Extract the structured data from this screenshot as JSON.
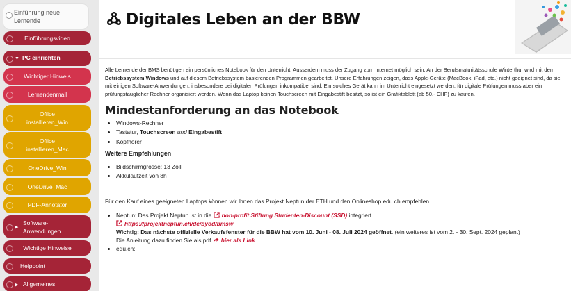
{
  "nav": {
    "top_label": "Einführung neue Lernende",
    "items": [
      {
        "label": "Einführungsvideo"
      },
      {
        "label": "PC einrichten"
      },
      {
        "label": "Wichtiger Hinweis"
      },
      {
        "label": "Lernendenmail"
      },
      {
        "label": "Office installieren_Win"
      },
      {
        "label": "Office installieren_Mac"
      },
      {
        "label": "OneDrive_Win"
      },
      {
        "label": "OneDrive_Mac"
      },
      {
        "label": "PDF-Annotator"
      },
      {
        "label": "Software-Anwendungen"
      },
      {
        "label": "Wichtige Hinweise"
      },
      {
        "label": "Helppoint"
      },
      {
        "label": "Allgemeines"
      }
    ]
  },
  "page": {
    "title": "Digitales Leben an der BBW",
    "intro": {
      "t1": "Alle Lernende der BMS benötigen ein persönliches Notebook für den Unterricht. Ausserdem muss der Zugang zum Internet möglich sein. An der Berufsmaturitätsschule Winterthur wird mit dem ",
      "b1": "Betriebssystem Windows",
      "t2": " und auf diesem Betriebssystem basierenden Programmen gearbeitet. Unsere Erfahrungen zeigen, dass Apple-Geräte (MacBook, iPad, etc.) nicht geeignet sind, da sie mit einigen Software-Anwendungen, insbesondere bei digitalen Prüfungen inkompatibel sind. Ein solches Gerät kann im Unterricht eingesetzt werden, für digitale Prüfungen muss aber ein prüfungstauglicher Rechner organisiert werden. Wenn das Laptop keinen Touchscreen mit Eingabestift besitzt, so ist ein Grafiktablett (ab 50.- CHF) zu kaufen."
    },
    "min_heading": "Mindestanforderung an das Notebook",
    "min_list": {
      "item1": "Windows-Rechner",
      "item2_a": "Tastatur, ",
      "item2_b": "Touchscreen",
      "item2_c": "und",
      "item2_d": "Eingabestift",
      "item3": "Kopfhörer"
    },
    "further_heading": "Weitere Empfehlungen",
    "further_list": [
      "Bildschirmgrösse: 13 Zoll",
      "Akkulaufzeit von 8h"
    ],
    "purchase_text": "Für den Kauf eines geeigneten Laptops können wir Ihnen das Projekt Neptun der ETH und den Onlineshop edu.ch empfehlen.",
    "neptun": {
      "prefix": "Neptun: Das Projekt Neptun ist in die ",
      "link1": "non-profit Stiftung Studenten-Discount (SSD)",
      "suffix": " integriert.",
      "link2": "https://projektneptun.ch/de/byod/bmsw",
      "important_bold": "Wichtig: Das nächste offizielle Verkaufsfenster für die BBW hat vom 10. Juni - 08. Juli 2024 geöffnet",
      "important_rest": ". (ein weiteres ist vom 2. - 30. Sept. 2024 geplant)",
      "pdf_prefix": "Die Anleitung dazu finden Sie als pdf ",
      "pdf_link": "hier als Link",
      "pdf_suffix": "."
    },
    "edu_item": "edu.ch:"
  },
  "colors": {
    "nav_red": "#a52437",
    "nav_pink": "#d3344d",
    "nav_yellow": "#e0a500",
    "link_red": "#c8102e"
  }
}
